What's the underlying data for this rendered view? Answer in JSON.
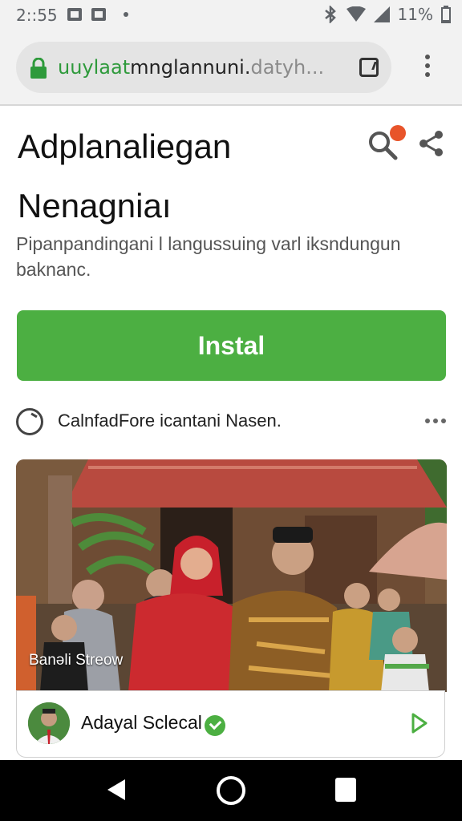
{
  "status_bar": {
    "time": "2::55",
    "battery": "11%"
  },
  "browser": {
    "url_green": "uuylaat",
    "url_dark": "mnglannuni.",
    "url_gray": "datyh..."
  },
  "app": {
    "title_line1": "Adplanaliegan",
    "title_line2": "Nenagniaı",
    "description": "Pipanpandingani l langussuing varl iksndungun baknanc.",
    "install_label": "Instal",
    "info_text": "CalnfadFore icantani Nasen."
  },
  "media": {
    "caption": "Banəli Streow",
    "channel_name": "Adayal Sclecal"
  },
  "colors": {
    "accent_green": "#4caf42",
    "url_green": "#2e9a3b",
    "notification_red": "#e8542a"
  },
  "icons": [
    "lock-icon",
    "tab-switcher-icon",
    "overflow-menu-icon",
    "search-icon",
    "share-icon",
    "clock-icon",
    "more-icon",
    "verified-icon",
    "play-icon",
    "back-icon",
    "home-icon",
    "recents-icon"
  ]
}
